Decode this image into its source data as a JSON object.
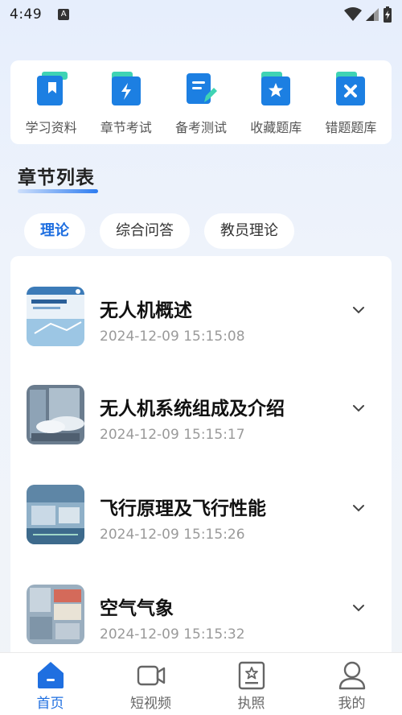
{
  "status_bar": {
    "time": "4:49",
    "notification_letter": "A"
  },
  "quick_actions": [
    {
      "label": "学习资料",
      "icon": "book-icon",
      "color": "#1c7fe2",
      "accent": "#3fd3b4"
    },
    {
      "label": "章节考试",
      "icon": "bolt-folder-icon",
      "color": "#1c7fe2",
      "accent": "#3fd3b4"
    },
    {
      "label": "备考测试",
      "icon": "edit-document-icon",
      "color": "#1c7fe2",
      "accent": "#3fd3b4"
    },
    {
      "label": "收藏题库",
      "icon": "star-folder-icon",
      "color": "#1c7fe2",
      "accent": "#3fd3b4"
    },
    {
      "label": "错题题库",
      "icon": "x-folder-icon",
      "color": "#1c7fe2",
      "accent": "#3fd3b4"
    }
  ],
  "section": {
    "title": "章节列表"
  },
  "tabs": [
    {
      "label": "理论",
      "active": true
    },
    {
      "label": "综合问答",
      "active": false
    },
    {
      "label": "教员理论",
      "active": false
    }
  ],
  "chapters": [
    {
      "title": "无人机概述",
      "date": "2024-12-09 15:15:08"
    },
    {
      "title": "无人机系统组成及介绍",
      "date": "2024-12-09 15:15:17"
    },
    {
      "title": "飞行原理及飞行性能",
      "date": "2024-12-09 15:15:26"
    },
    {
      "title": "空气气象",
      "date": "2024-12-09 15:15:32"
    }
  ],
  "bottom_nav": [
    {
      "label": "首页",
      "icon": "home-icon",
      "active": true
    },
    {
      "label": "短视频",
      "icon": "video-camera-icon",
      "active": false
    },
    {
      "label": "执照",
      "icon": "license-icon",
      "active": false
    },
    {
      "label": "我的",
      "icon": "user-icon",
      "active": false
    }
  ],
  "colors": {
    "accent": "#1f6fe0",
    "icon_blue": "#1c7fe2",
    "icon_teal": "#3fd3b4"
  }
}
